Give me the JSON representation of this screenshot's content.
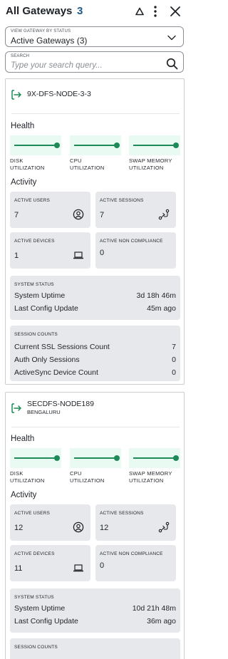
{
  "header": {
    "title": "All Gateways",
    "count": "3"
  },
  "filter": {
    "label": "VIEW GATEWAY BY STATUS",
    "value": "Active Gateways (3)"
  },
  "search": {
    "label": "SEARCH",
    "placeholder": "Type your search query..."
  },
  "labels": {
    "health": "Health",
    "activity": "Activity",
    "disk": "DISK\nUTILIZATION",
    "cpu": "CPU\nUTILIZATION",
    "swap": "SWAP MEMORY\nUTILIZATION",
    "active_users": "ACTIVE USERS",
    "active_sessions": "ACTIVE SESSIONS",
    "active_devices": "ACTIVE DEVICES",
    "active_non_compliance": "ACTIVE NON COMPLIANCE",
    "system_status": "SYSTEM STATUS",
    "system_uptime": "System Uptime",
    "last_config_update": "Last Config Update",
    "session_counts": "SESSION COUNTS",
    "ssl_sessions": "Current SSL Sessions Count",
    "auth_only": "Auth Only Sessions",
    "activesync": "ActiveSync Device Count"
  },
  "colors": {
    "accent_count": "#1e5b86",
    "health_green": "#1d8a58",
    "health_bg": "#e8faf1",
    "tile_bg": "#e6e8eb"
  },
  "gateways": [
    {
      "name": "9X-DFS-NODE-3-3",
      "location": "",
      "active_users": "7",
      "active_sessions": "7",
      "active_devices": "1",
      "active_non_compliance": "0",
      "system_uptime": "3d 18h 46m",
      "last_config_update": "45m ago",
      "ssl_sessions": "7",
      "auth_only": "0",
      "activesync": "0"
    },
    {
      "name": "SECDFS-NODE189",
      "location": "BENGALURU",
      "active_users": "12",
      "active_sessions": "12",
      "active_devices": "11",
      "active_non_compliance": "0",
      "system_uptime": "10d 21h 48m",
      "last_config_update": "36m ago"
    }
  ]
}
